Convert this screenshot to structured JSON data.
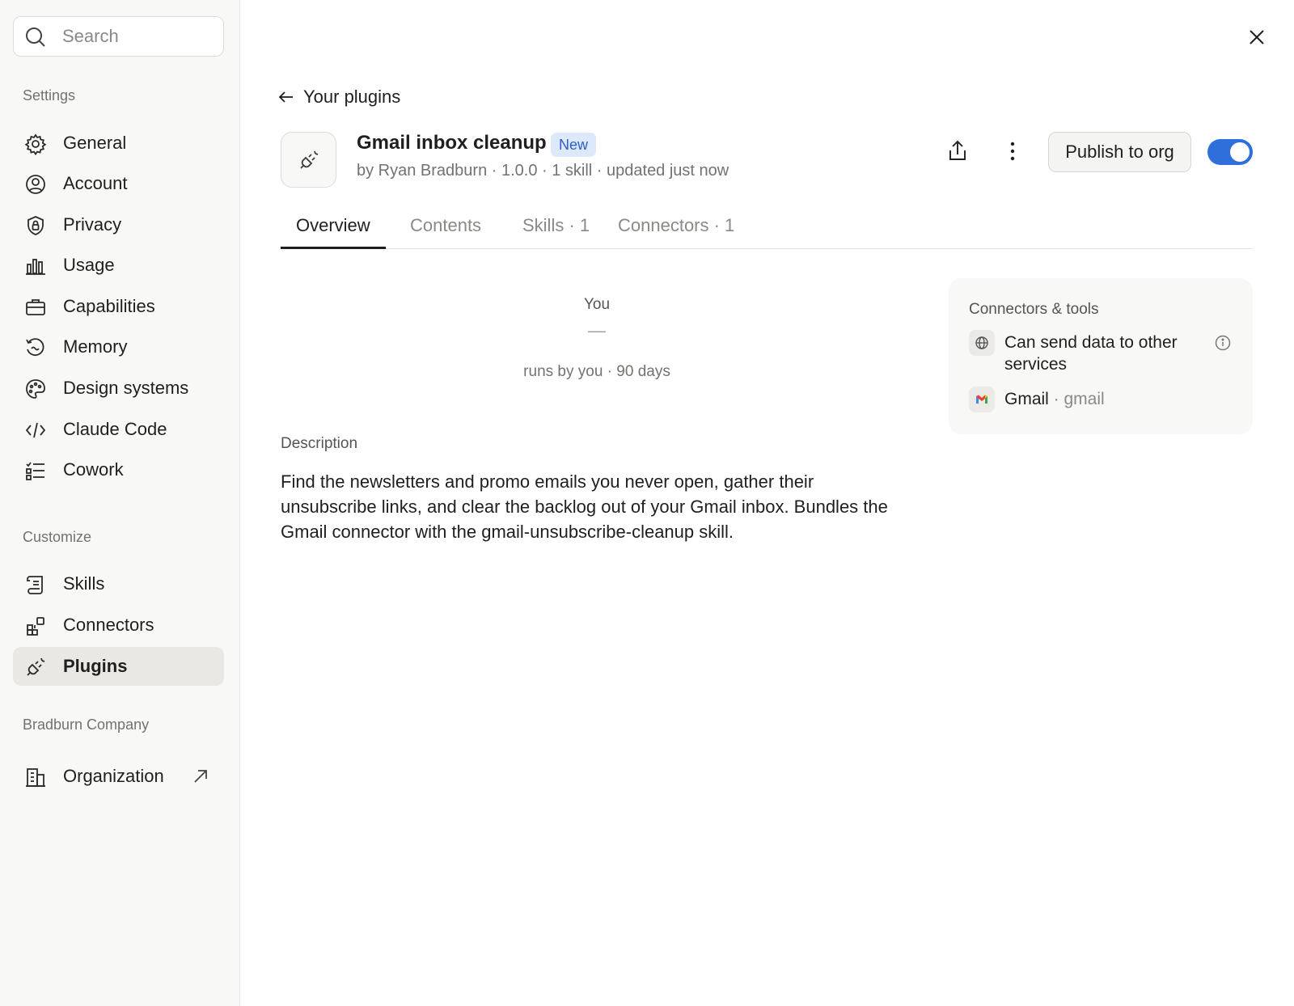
{
  "search": {
    "placeholder": "Search"
  },
  "sidebar": {
    "settings_label": "Settings",
    "customize_label": "Customize",
    "company_label": "Bradburn Company",
    "settings_items": [
      {
        "label": "General",
        "icon": "gear-icon"
      },
      {
        "label": "Account",
        "icon": "user-circle-icon"
      },
      {
        "label": "Privacy",
        "icon": "shield-lock-icon"
      },
      {
        "label": "Usage",
        "icon": "bar-chart-icon"
      },
      {
        "label": "Capabilities",
        "icon": "briefcase-icon"
      },
      {
        "label": "Memory",
        "icon": "memory-icon"
      },
      {
        "label": "Design systems",
        "icon": "palette-icon"
      },
      {
        "label": "Claude Code",
        "icon": "code-icon"
      },
      {
        "label": "Cowork",
        "icon": "checklist-icon"
      }
    ],
    "customize_items": [
      {
        "label": "Skills",
        "icon": "scroll-icon"
      },
      {
        "label": "Connectors",
        "icon": "connectors-icon"
      },
      {
        "label": "Plugins",
        "icon": "plug-icon",
        "active": true
      }
    ],
    "company_items": [
      {
        "label": "Organization",
        "icon": "building-icon",
        "external": true
      }
    ]
  },
  "header": {
    "back_label": "Your plugins",
    "title": "Gmail inbox cleanup",
    "badge": "New",
    "meta": "by Ryan Bradburn · 1.0.0 · 1 skill · updated just now",
    "publish_label": "Publish to org",
    "enabled": true
  },
  "tabs": [
    {
      "label": "Overview",
      "active": true
    },
    {
      "label": "Contents"
    },
    {
      "label": "Skills · 1"
    },
    {
      "label": "Connectors · 1"
    }
  ],
  "stats": {
    "label": "You",
    "value": "—",
    "caption": "runs by you · 90 days"
  },
  "description": {
    "label": "Description",
    "text": "Find the newsletters and promo emails you never open, gather their unsubscribe links, and clear the backlog out of your Gmail inbox. Bundles the Gmail connector with the gmail-unsubscribe-cleanup skill."
  },
  "tools": {
    "title": "Connectors & tools",
    "items": [
      {
        "label": "Can send data to other services",
        "icon": "globe-icon"
      },
      {
        "label": "Gmail",
        "sub": " · gmail",
        "icon": "gmail-icon"
      }
    ]
  },
  "colors": {
    "accent": "#2f6fdb",
    "badge_bg": "#dde8fb",
    "badge_text": "#2c5fc4",
    "sidebar_bg": "#f8f8f6"
  }
}
